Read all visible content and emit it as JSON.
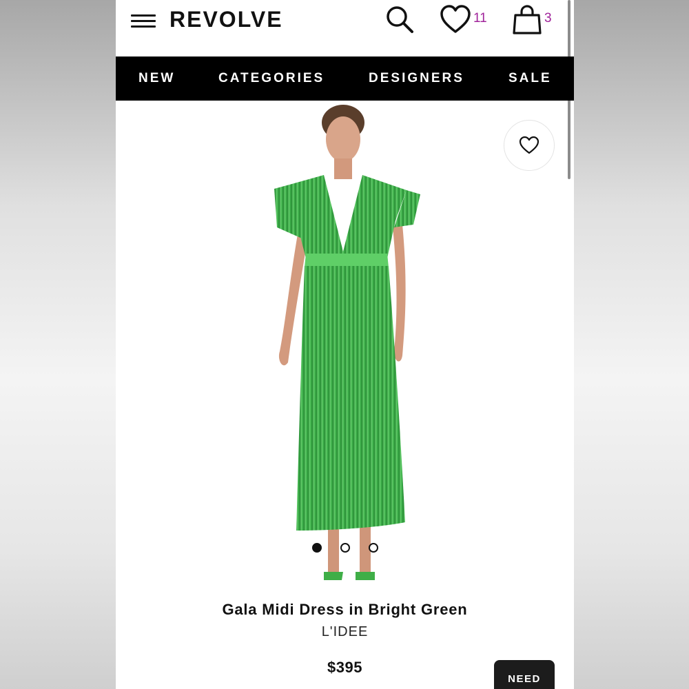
{
  "header": {
    "logo": "REVOLVE",
    "wishlist_count": "11",
    "bag_count": "3"
  },
  "nav": {
    "items": [
      "NEW",
      "CATEGORIES",
      "DESIGNERS",
      "SALE"
    ]
  },
  "product": {
    "title": "Gala Midi Dress in Bright Green",
    "brand": "L'IDEE",
    "price": "$395",
    "image_dots": 3,
    "active_dot": 1,
    "dress_color": "#3fae47"
  },
  "cta": {
    "label": "NEED"
  },
  "colors": {
    "accent_count": "#a0239a",
    "nav_bg": "#000000"
  }
}
